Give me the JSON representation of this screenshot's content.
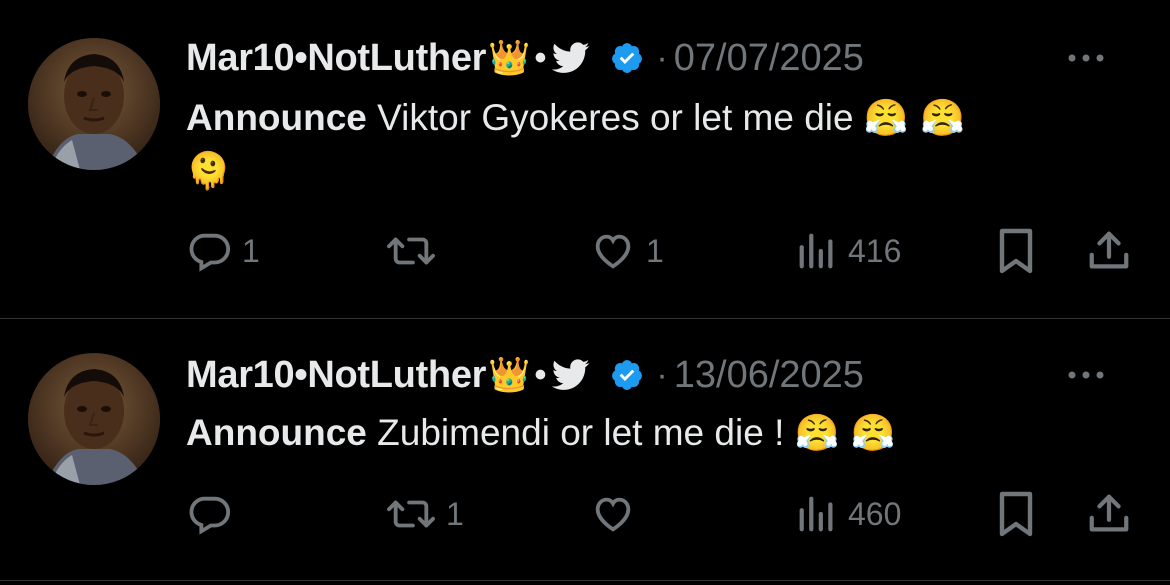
{
  "tweets": [
    {
      "author": "Mar10•NotLuther",
      "crown": "👑",
      "dot": "•",
      "separator": "·",
      "date": "07/07/2025",
      "text_bold": "Announce",
      "text_rest": " Viktor Gyokeres or let me die ",
      "emojis": "😤 😤",
      "emoji_line2": "🫠",
      "reply_count": "1",
      "retweet_count": "",
      "like_count": "1",
      "views_count": "416"
    },
    {
      "author": "Mar10•NotLuther",
      "crown": "👑",
      "dot": "•",
      "separator": "·",
      "date": "13/06/2025",
      "text_bold": "Announce",
      "text_rest": " Zubimendi or let me die ! ",
      "emojis": "😤 😤",
      "emoji_line2": "",
      "reply_count": "",
      "retweet_count": "1",
      "like_count": "",
      "views_count": "460"
    }
  ],
  "colors": {
    "background": "#000000",
    "text": "#e7e9ea",
    "muted": "#71767b",
    "verified": "#1d9bf0",
    "divider": "#2f3336"
  },
  "icons": [
    "chat-bubble-icon",
    "retweet-icon",
    "heart-icon",
    "views-bar-chart-icon",
    "bookmark-icon",
    "share-icon",
    "bird-icon",
    "verified-badge-icon",
    "more-dots-icon"
  ]
}
